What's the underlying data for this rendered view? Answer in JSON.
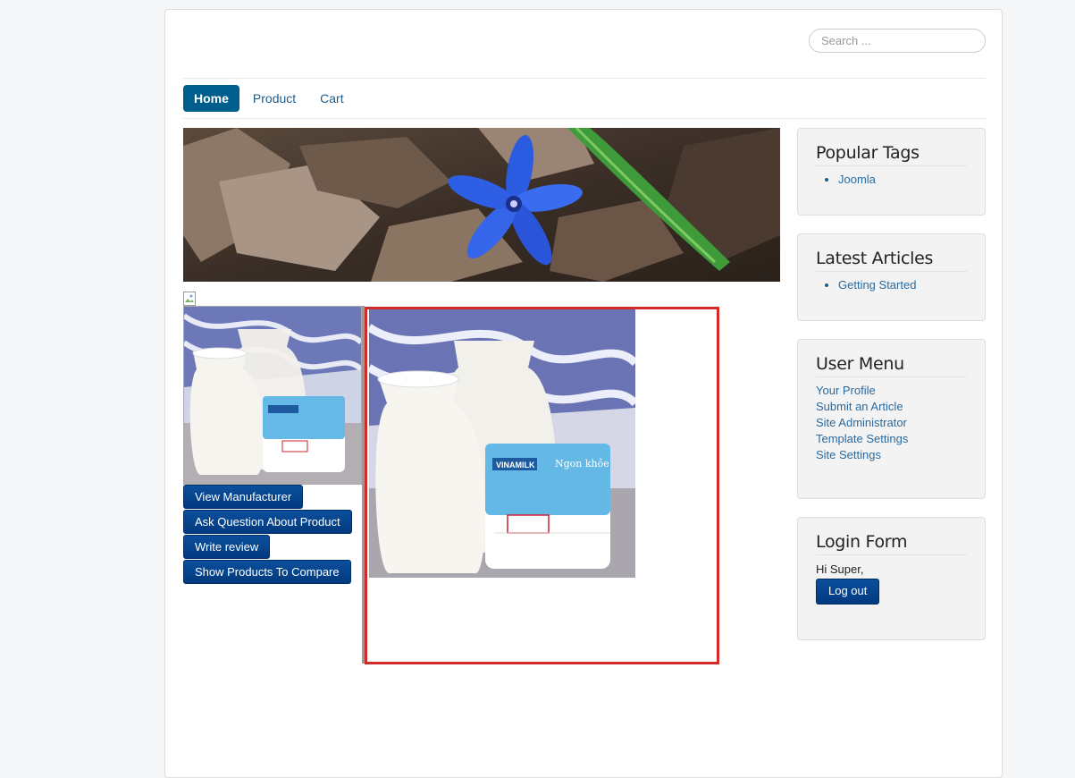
{
  "search": {
    "placeholder": "Search ..."
  },
  "nav": {
    "items": [
      "Home",
      "Product",
      "Cart"
    ]
  },
  "product": {
    "buttons": {
      "view_manufacturer": "View Manufacturer",
      "ask_question": "Ask Question About Product",
      "write_review": "Write review",
      "compare": "Show Products To Compare"
    },
    "package_brand": "VINAMILK",
    "package_name": "Ngon khỏe"
  },
  "sidebar": {
    "popular_tags": {
      "title": "Popular Tags",
      "items": [
        "Joomla"
      ]
    },
    "latest_articles": {
      "title": "Latest Articles",
      "items": [
        "Getting Started"
      ]
    },
    "user_menu": {
      "title": "User Menu",
      "items": [
        "Your Profile",
        "Submit an Article",
        "Site Administrator",
        "Template Settings",
        "Site Settings"
      ]
    },
    "login_form": {
      "title": "Login Form",
      "greeting": "Hi Super,",
      "logout_label": "Log out"
    }
  },
  "colors": {
    "accent": "#005e8d",
    "button": "#013a7f",
    "zoom_border": "#d32a2a"
  }
}
